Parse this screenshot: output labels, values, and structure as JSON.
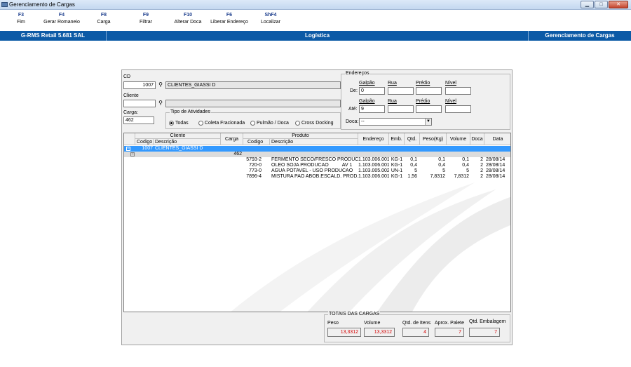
{
  "window": {
    "title": "Gerenciamento de Cargas",
    "min": "▁",
    "max": "□",
    "close": "✕"
  },
  "toolbar": [
    {
      "key": "F3",
      "label": "Fim"
    },
    {
      "key": "F4",
      "label": "Gerar Romaneio"
    },
    {
      "key": "F8",
      "label": "Carga"
    },
    {
      "key": "F9",
      "label": "Filtrar"
    },
    {
      "key": "F10",
      "label": "Alterar Doca"
    },
    {
      "key": "F6",
      "label": "Liberar Endereço"
    },
    {
      "key": "ShF4",
      "label": "Localizar"
    }
  ],
  "status": {
    "system": "G-RMS Retail 5.681 SAL",
    "module": "Logística",
    "screen": "Gerenciamento de Cargas"
  },
  "filters": {
    "cd_label": "CD",
    "cd_code": "1007",
    "cd_name": "CLIENTES_GIASSI D",
    "cliente_label": "Cliente",
    "cliente_code": "",
    "cliente_name": "",
    "carga_label": "Carga:",
    "carga_value": "462",
    "tipo_label": "Tipo de Atividades",
    "tipo_options": [
      "Todas",
      "Coleta Fracionada",
      "Pulmão / Doca",
      "Cross Docking"
    ],
    "tipo_selected": "Todas"
  },
  "enderecos": {
    "legend": "Endereços",
    "headers": [
      "Galpão",
      "Rua",
      "Prédio",
      "Nível"
    ],
    "de_label": "De:",
    "ate_label": "Até:",
    "de_galpao": "0",
    "ate_galpao": "9",
    "doca_label": "Doca:",
    "doca_value": "--"
  },
  "grid": {
    "headers": {
      "cliente": "Cliente",
      "codigo": "Codigo",
      "descricao": "Descrição",
      "carga": "Carga",
      "produto": "Produto",
      "endereco": "Endereço",
      "emb": "Emb.",
      "qtd": "Qtd.",
      "peso": "Peso(Kg)",
      "volume": "Volume",
      "doca": "Doca",
      "data": "Data"
    },
    "client_row": {
      "toggle": "−",
      "codigo": "1007",
      "descricao": "CLIENTES_GIASSI D"
    },
    "carga_row": {
      "toggle": "−",
      "carga": "462"
    },
    "rows": [
      {
        "codigo": "5793-2",
        "descricao": "FERMENTO SECO/FRESCO PRODUCA",
        "endereco": "1.103.006.001",
        "emb": "KG-1",
        "qtd": "0,1",
        "peso": "0,1",
        "volume": "0,1",
        "doca": "2",
        "data": "28/08/14"
      },
      {
        "codigo": "720-0",
        "descricao": "OLEO SOJA PRODUCAO          AV 1",
        "endereco": "1.103.006.001",
        "emb": "KG-1",
        "qtd": "0,4",
        "peso": "0,4",
        "volume": "0,4",
        "doca": "2",
        "data": "28/08/14"
      },
      {
        "codigo": "773-0",
        "descricao": "AGUA POTAVEL - USO PRODUCAO",
        "endereco": "1.103.005.002",
        "emb": "UN-1",
        "qtd": "5",
        "peso": "5",
        "volume": "5",
        "doca": "2",
        "data": "28/08/14"
      },
      {
        "codigo": "7896-4",
        "descricao": "MISTURA PAO ABOB.ESCALD. PROD.",
        "endereco": "1.103.006.001",
        "emb": "KG-1",
        "qtd": "1,56",
        "peso": "7,8312",
        "volume": "7,8312",
        "doca": "2",
        "data": "28/08/14"
      }
    ]
  },
  "totals": {
    "legend": "TOTAIS DAS CARGAS",
    "labels": [
      "Peso",
      "Volume",
      "Qtd. de Itens",
      "Aprox. Palete",
      "Qtd. Embalagem"
    ],
    "values": [
      "13,3312",
      "13,3312",
      "4",
      "7",
      "7"
    ],
    "value_color": "#d40000"
  },
  "icons": {
    "binoculars": "binoculars-icon"
  },
  "colors": {
    "status_bar": "#0c5aa6",
    "selection": "#3399ff",
    "toolbar_key": "#1a3c8c"
  }
}
